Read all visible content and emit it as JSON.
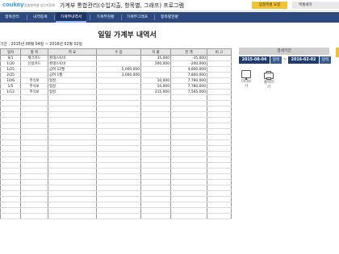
{
  "header": {
    "logo": "coukey",
    "subtitle": "맞춤형엑셀 업무자동화",
    "app_title": "가계부 통합관리(수입지출, 항목별, 그래프) 프로그램",
    "custom_excel_button": "맞춤엑셀 요청",
    "right_button": "엑셀세미"
  },
  "tabs": [
    {
      "label": "항목관리"
    },
    {
      "label": "내역등록"
    },
    {
      "label": "가계부내역서"
    },
    {
      "label": "가계부현황"
    },
    {
      "label": "가계부그래프"
    },
    {
      "label": "항목별현황"
    }
  ],
  "main": {
    "title": "일일 가계부 내역서",
    "period_text": "기간 :  2015년 08월 04일 ~ 2016년 02월 02일"
  },
  "search": {
    "header": "검색기간",
    "start_date": "2015-08-04",
    "end_date": "2016-02-02",
    "calendar_label": "달력",
    "tilde": "~"
  },
  "actions": {
    "preview_label": "미리보기",
    "print_label": "출력하기",
    "preview_icon": "monitor-icon",
    "print_icon": "printer-icon"
  },
  "table": {
    "columns": [
      "일자",
      "항 목",
      "적 요",
      "수 입",
      "지 출",
      "잔 액",
      "비 고"
    ],
    "rows": [
      [
        "9/1",
        "체크카드",
        "롯데스토비",
        "",
        "35,000",
        "-35,000",
        ""
      ],
      [
        "1/20",
        "신용카드",
        "롯데스토비",
        "",
        "200,000",
        "-200,000",
        ""
      ],
      [
        "1/25",
        "",
        "급여 12월",
        "5,000,000",
        "",
        "4,800,000",
        ""
      ],
      [
        "2/25",
        "",
        "급여 1월",
        "3,000,000",
        "",
        "7,800,000",
        ""
      ],
      [
        "10/6",
        "주식보",
        "협성",
        "",
        "10,000",
        "7,790,000",
        ""
      ],
      [
        "1/5",
        "주식보",
        "협성",
        "",
        "10,000",
        "7,780,000",
        ""
      ],
      [
        "1/12",
        "주식보",
        "협성",
        "",
        "215,000",
        "7,565,000",
        ""
      ]
    ],
    "empty_rows": 22
  }
}
